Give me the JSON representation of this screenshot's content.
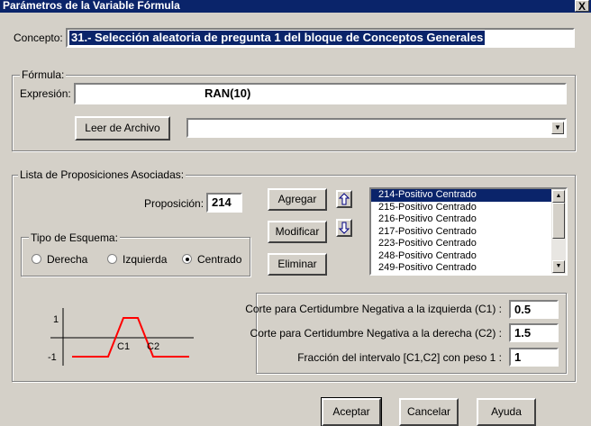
{
  "window": {
    "title": "Parámetros de la Variable Fórmula",
    "close_label": "X"
  },
  "concepto": {
    "label": "Concepto:",
    "value": "31.-  Selección aleatoria de pregunta 1 del bloque de Conceptos Generales"
  },
  "formula": {
    "group_label": "Fórmula:",
    "expresion_label": "Expresión:",
    "expresion_value": "RAN(10)",
    "leer_button": "Leer de Archivo",
    "file_value": ""
  },
  "lista": {
    "group_label": "Lista de Proposiciones Asociadas:",
    "proposicion_label": "Proposición:",
    "proposicion_value": "214",
    "buttons": {
      "agregar": "Agregar",
      "modificar": "Modificar",
      "eliminar": "Eliminar"
    },
    "items": [
      "214-Positivo Centrado",
      "215-Positivo Centrado",
      "216-Positivo Centrado",
      "217-Positivo Centrado",
      "223-Positivo Centrado",
      "248-Positivo Centrado",
      "249-Positivo Centrado"
    ],
    "selected_index": 0
  },
  "esquema": {
    "group_label": "Tipo de Esquema:",
    "options": [
      "Derecha",
      "Izquierda",
      "Centrado"
    ],
    "selected": "Centrado"
  },
  "diagram": {
    "y_top": "1",
    "y_bottom": "-1",
    "c1": "C1",
    "c2": "C2",
    "line_color": "#ff0000"
  },
  "cortes": {
    "c1_label": "Corte para Certidumbre Negativa a la izquierda (C1) :",
    "c1_value": "0.5",
    "c2_label": "Corte para Certidumbre Negativa a la derecha (C2) :",
    "c2_value": "1.5",
    "frac_label": "Fracción del intervalo [C1,C2] con peso 1 :",
    "frac_value": "1"
  },
  "footer": {
    "aceptar": "Aceptar",
    "cancelar": "Cancelar",
    "ayuda": "Ayuda"
  }
}
